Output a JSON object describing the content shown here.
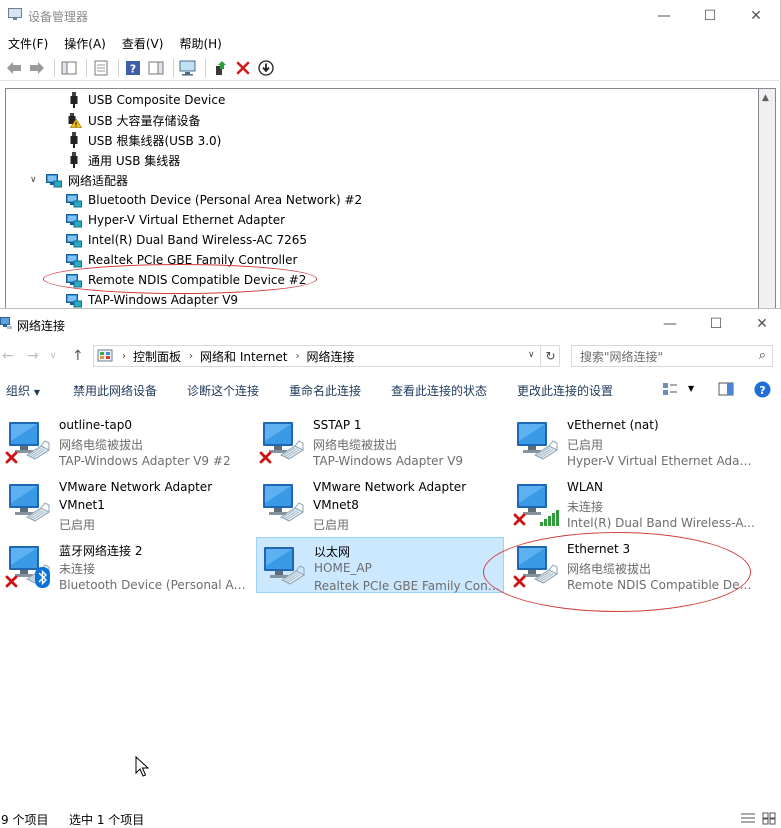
{
  "device_manager": {
    "title": "设备管理器",
    "menu": [
      "文件(F)",
      "操作(A)",
      "查看(V)",
      "帮助(H)"
    ],
    "tree": [
      {
        "label": "USB Composite Device",
        "icon": "usb-plug-icon",
        "indent": 2
      },
      {
        "label": "USB 大容量存储设备",
        "icon": "warning-icon",
        "indent": 2
      },
      {
        "label": "USB 根集线器(USB 3.0)",
        "icon": "usb-plug-icon",
        "indent": 2
      },
      {
        "label": "通用 USB 集线器",
        "icon": "usb-plug-icon",
        "indent": 2
      },
      {
        "label": "网络适配器",
        "icon": "network-adapter-icon",
        "indent": 1,
        "expanded": true
      },
      {
        "label": "Bluetooth Device (Personal Area Network) #2",
        "icon": "network-adapter-icon",
        "indent": 2
      },
      {
        "label": "Hyper-V Virtual Ethernet Adapter",
        "icon": "network-adapter-icon",
        "indent": 2
      },
      {
        "label": "Intel(R) Dual Band Wireless-AC 7265",
        "icon": "network-adapter-icon",
        "indent": 2
      },
      {
        "label": "Realtek PCIe GBE Family Controller",
        "icon": "network-adapter-icon",
        "indent": 2
      },
      {
        "label": "Remote NDIS Compatible Device #2",
        "icon": "network-adapter-icon",
        "indent": 2
      },
      {
        "label": "TAP-Windows Adapter V9",
        "icon": "network-adapter-icon",
        "indent": 2
      }
    ]
  },
  "network_connections": {
    "title": "网络连接",
    "breadcrumb": [
      "控制面板",
      "网络和 Internet",
      "网络连接"
    ],
    "search_placeholder": "搜索\"网络连接\"",
    "commands": [
      "组织",
      "禁用此网络设备",
      "诊断这个连接",
      "重命名此连接",
      "查看此连接的状态",
      "更改此连接的设置"
    ],
    "connections": [
      {
        "name": "outline-tap0",
        "status": "网络电缆被拔出",
        "device": "TAP-Windows Adapter V9 #2",
        "badge": "x"
      },
      {
        "name": "SSTAP 1",
        "status": "网络电缆被拔出",
        "device": "TAP-Windows Adapter V9",
        "badge": "x"
      },
      {
        "name": "vEthernet (nat)",
        "status": "已启用",
        "device": "Hyper-V Virtual Ethernet Adap...",
        "badge": ""
      },
      {
        "name": "VMware Network Adapter VMnet1",
        "status": "",
        "device": "已启用",
        "badge": "",
        "two_line_name": true,
        "name_a": "VMware Network Adapter",
        "name_b": "VMnet1"
      },
      {
        "name": "VMware Network Adapter VMnet8",
        "status": "",
        "device": "已启用",
        "badge": "",
        "two_line_name": true,
        "name_a": "VMware Network Adapter",
        "name_b": "VMnet8"
      },
      {
        "name": "WLAN",
        "status": "未连接",
        "device": "Intel(R) Dual Band Wireless-A...",
        "badge": "x-signal"
      },
      {
        "name": "蓝牙网络连接 2",
        "status": "未连接",
        "device": "Bluetooth Device (Personal Ar...",
        "badge": "x-bluetooth"
      },
      {
        "name": "以太网",
        "status": "HOME_AP",
        "device": "Realtek PCIe GBE Family Contr...",
        "badge": "",
        "selected": true
      },
      {
        "name": "Ethernet 3",
        "status": "网络电缆被拔出",
        "device": "Remote NDIS Compatible Dev...",
        "badge": "x"
      }
    ],
    "status_bar": {
      "items": "9 个项目",
      "selected": "选中 1 个项目"
    }
  },
  "colors": {
    "annotation": "#d23c3c",
    "selection": "#cce8ff",
    "accent": "#1e6fd9"
  }
}
